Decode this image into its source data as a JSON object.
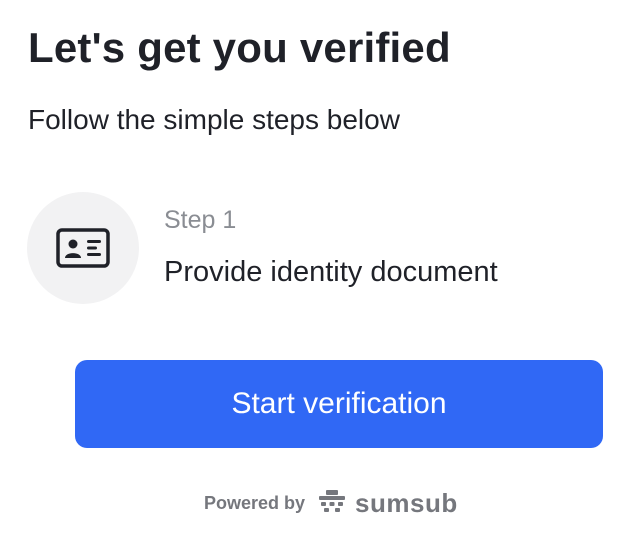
{
  "header": {
    "title": "Let's get you verified",
    "subtitle": "Follow the simple steps below"
  },
  "steps": [
    {
      "number": "Step 1",
      "label": "Provide identity document",
      "icon": "id-card-icon"
    }
  ],
  "actions": {
    "start_label": "Start verification"
  },
  "footer": {
    "powered_by": "Powered by",
    "brand": "sumsub",
    "brand_icon": "sumsub-logo-icon"
  },
  "colors": {
    "primary_button": "#3068f5",
    "text": "#1f2128",
    "muted_text": "#8a8d93",
    "icon_circle": "#f2f2f3",
    "footer_text": "#75777d"
  }
}
